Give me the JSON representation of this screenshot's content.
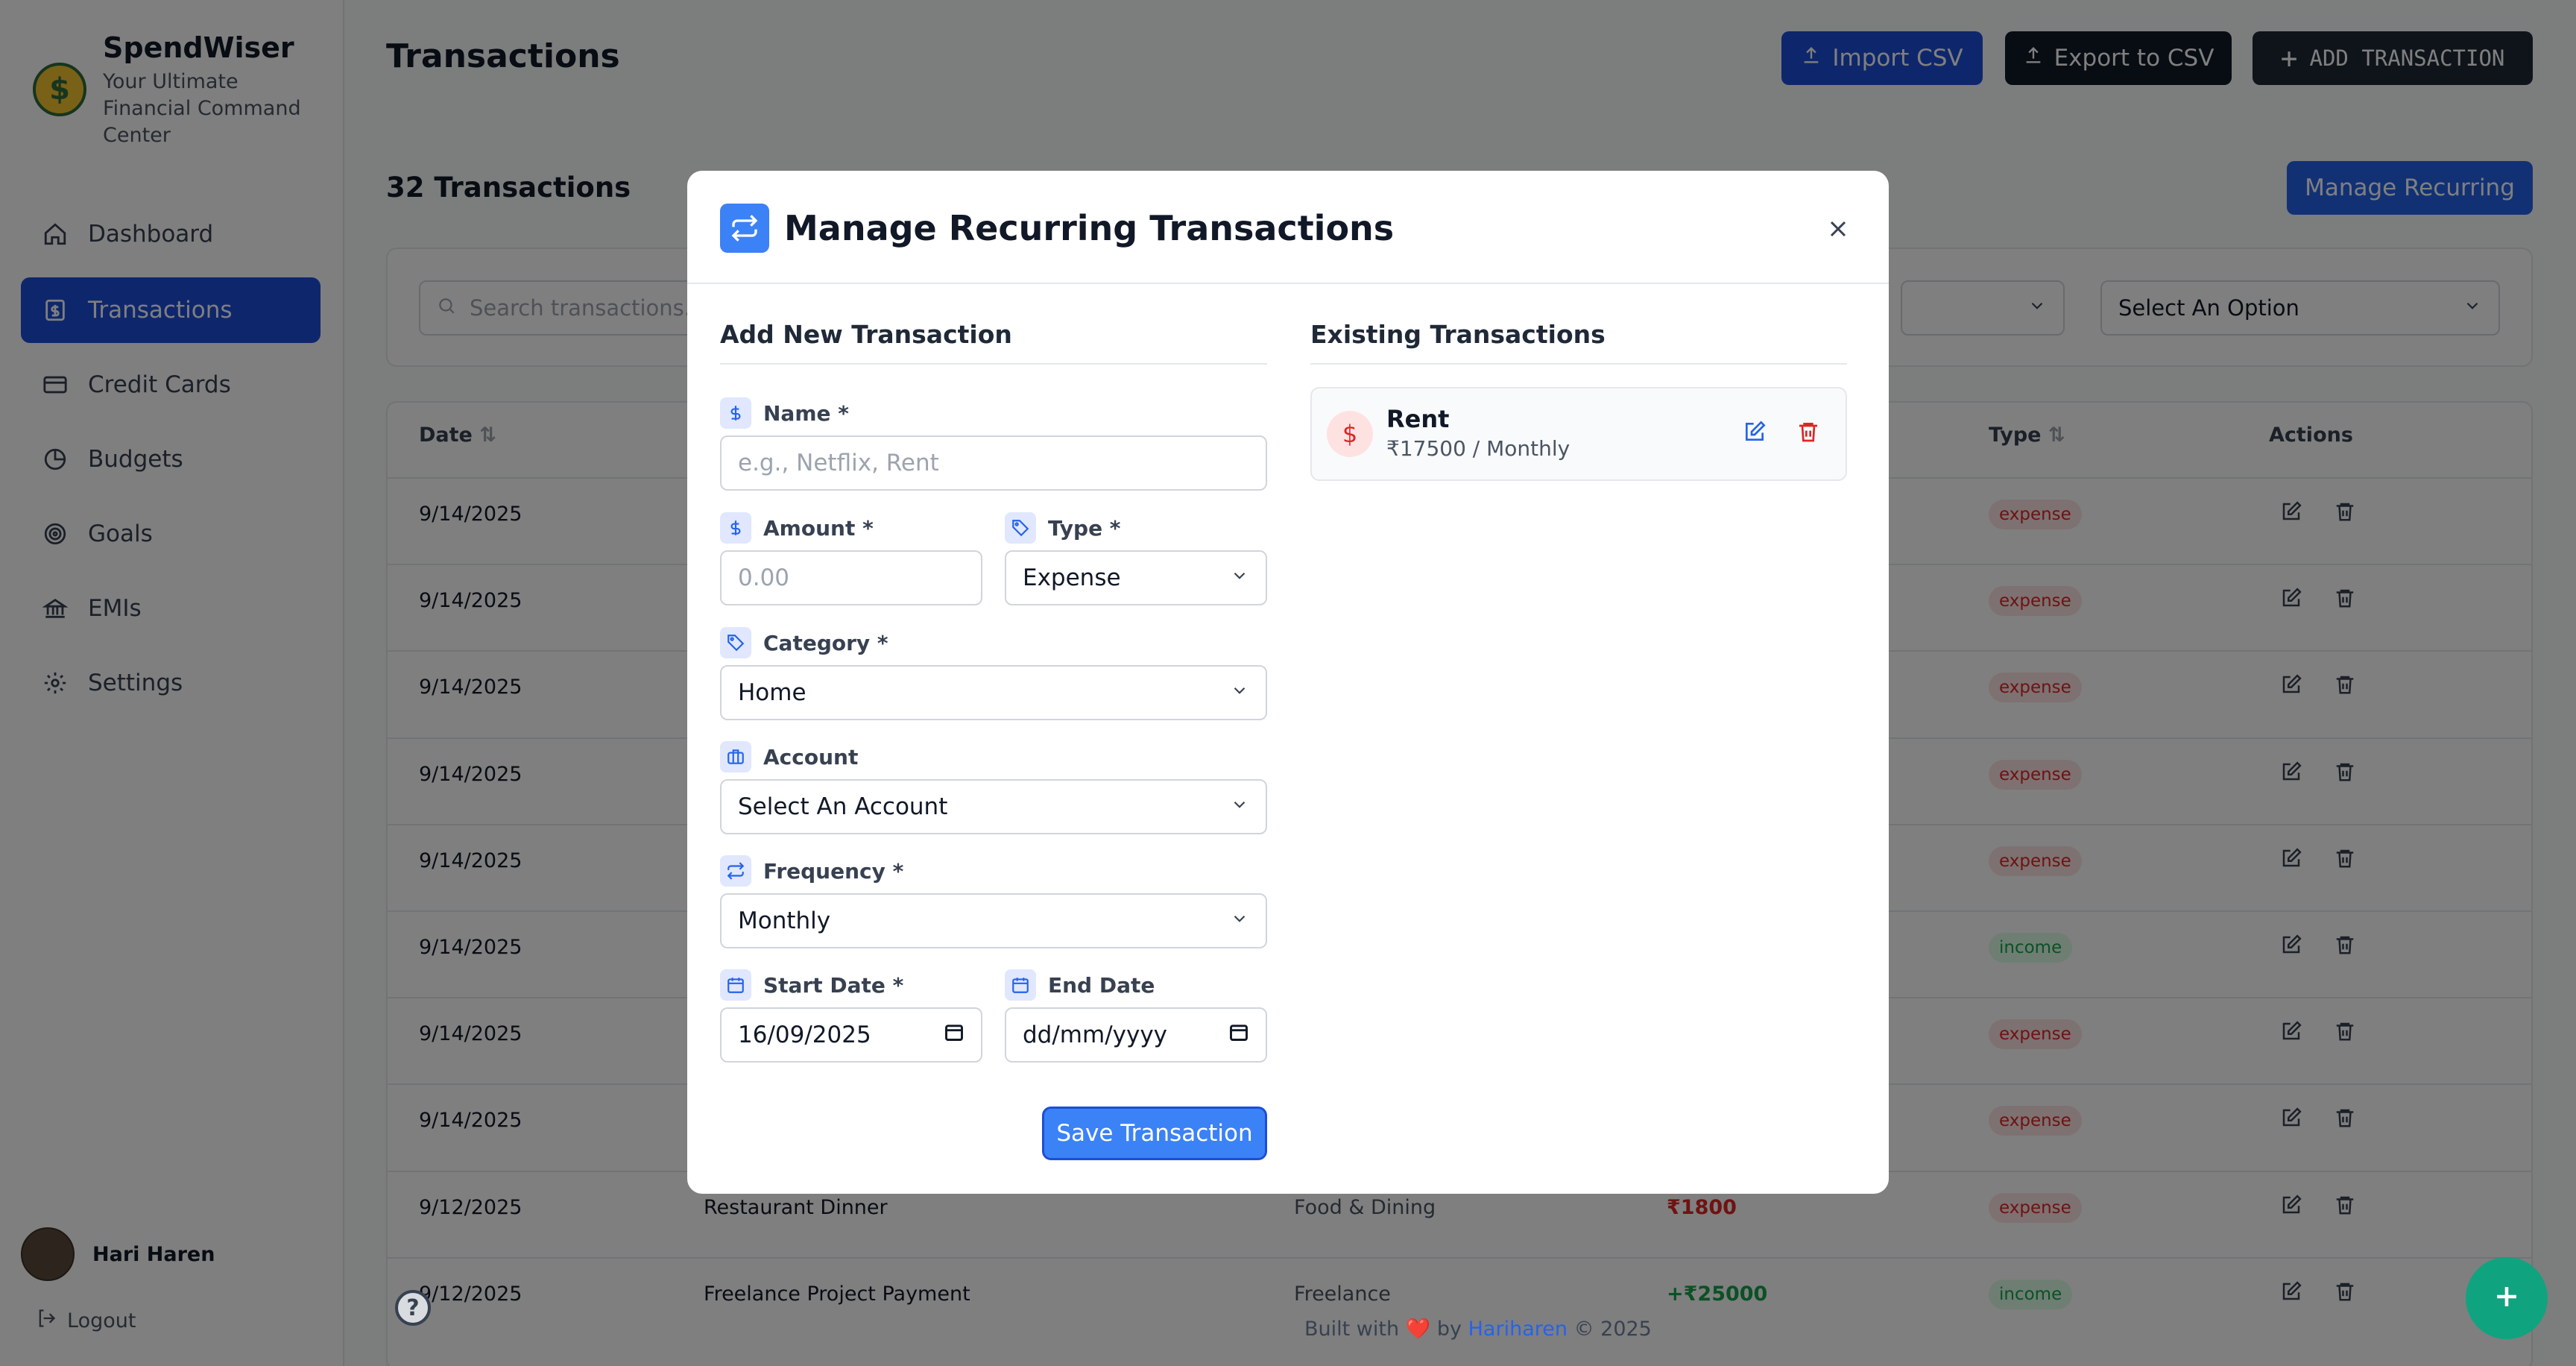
{
  "brand": {
    "name": "SpendWiser",
    "tagline": "Your Ultimate Financial Command Center",
    "logo_icon": "money-face-icon"
  },
  "nav": [
    {
      "label": "Dashboard",
      "icon": "home-icon",
      "active": false
    },
    {
      "label": "Transactions",
      "icon": "dollar-doc-icon",
      "active": true
    },
    {
      "label": "Credit Cards",
      "icon": "credit-card-icon",
      "active": false
    },
    {
      "label": "Budgets",
      "icon": "pie-chart-icon",
      "active": false
    },
    {
      "label": "Goals",
      "icon": "target-icon",
      "active": false
    },
    {
      "label": "EMIs",
      "icon": "bank-icon",
      "active": false
    },
    {
      "label": "Settings",
      "icon": "gear-icon",
      "active": false
    }
  ],
  "user": {
    "name": "Hari Haren",
    "logout": "Logout"
  },
  "header": {
    "title": "Transactions",
    "import_label": "Import CSV",
    "export_label": "Export to CSV",
    "add_label": "ADD TRANSACTION"
  },
  "summary": {
    "count_label": "32 Transactions",
    "manage_recurring": "Manage Recurring"
  },
  "filters": {
    "search_placeholder": "Search transactions...",
    "select_placeholder": "Select An Option"
  },
  "table": {
    "headers": {
      "date": "Date",
      "type": "Type",
      "actions": "Actions"
    },
    "rows": [
      {
        "date": "9/14/2025",
        "name": "",
        "category": "",
        "amount": "",
        "type": "expense"
      },
      {
        "date": "9/14/2025",
        "name": "",
        "category": "",
        "amount": "",
        "type": "expense"
      },
      {
        "date": "9/14/2025",
        "name": "",
        "category": "",
        "amount": "",
        "type": "expense"
      },
      {
        "date": "9/14/2025",
        "name": "",
        "category": "",
        "amount": "",
        "type": "expense"
      },
      {
        "date": "9/14/2025",
        "name": "",
        "category": "",
        "amount": "",
        "type": "expense"
      },
      {
        "date": "9/14/2025",
        "name": "",
        "category": "",
        "amount": "",
        "type": "income"
      },
      {
        "date": "9/14/2025",
        "name": "",
        "category": "",
        "amount": "",
        "type": "expense"
      },
      {
        "date": "9/14/2025",
        "name": "",
        "category": "",
        "amount": "",
        "type": "expense"
      },
      {
        "date": "9/12/2025",
        "name": "Restaurant Dinner",
        "category": "Food & Dining",
        "amount": "₹1800",
        "type": "expense"
      },
      {
        "date": "9/12/2025",
        "name": "Freelance Project Payment",
        "category": "Freelance",
        "amount": "+₹25000",
        "type": "income"
      }
    ]
  },
  "footer": {
    "prefix": "Built with",
    "heart": "❤️",
    "by": "by",
    "author": "Hariharen",
    "year": "© 2025"
  },
  "modal": {
    "title": "Manage Recurring Transactions",
    "add_section": "Add New Transaction",
    "existing_section": "Existing Transactions",
    "fields": {
      "name_label": "Name *",
      "name_placeholder": "e.g., Netflix, Rent",
      "amount_label": "Amount *",
      "amount_placeholder": "0.00",
      "type_label": "Type *",
      "type_value": "Expense",
      "category_label": "Category *",
      "category_value": "Home",
      "account_label": "Account",
      "account_value": "Select An Account",
      "frequency_label": "Frequency *",
      "frequency_value": "Monthly",
      "start_label": "Start Date *",
      "start_value": "16/09/2025",
      "end_label": "End Date",
      "end_value": "dd/mm/yyyy"
    },
    "save_label": "Save Transaction",
    "existing": [
      {
        "name": "Rent",
        "detail": "₹17500 / Monthly"
      }
    ]
  },
  "colors": {
    "primary": "#1d4ed8",
    "accent": "#3b82f6",
    "expense": "#dc2626",
    "income": "#16a34a",
    "fab": "#10a37f"
  }
}
